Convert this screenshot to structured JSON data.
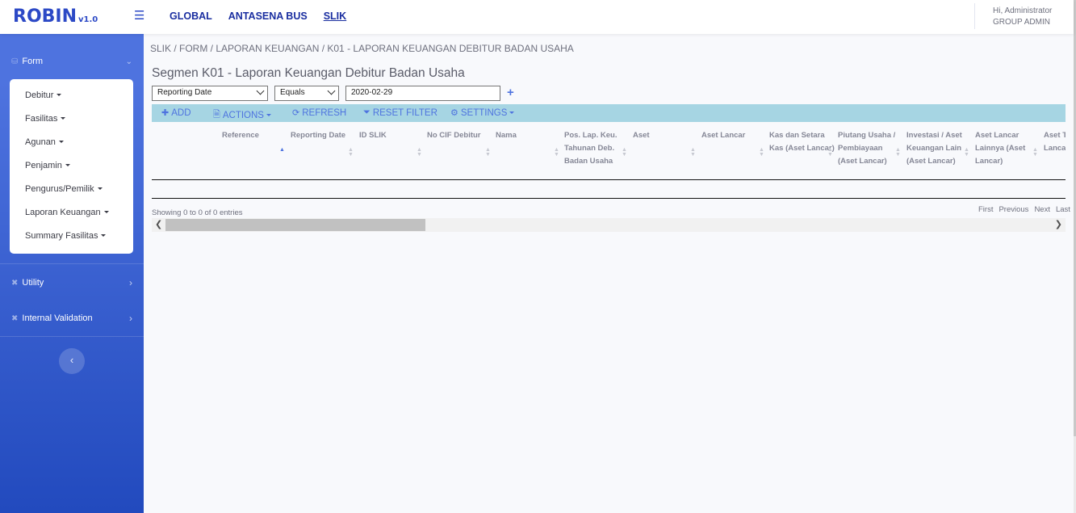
{
  "brand": {
    "name": "ROBIN",
    "version": "v1.0"
  },
  "topnav": [
    "GLOBAL",
    "ANTASENA BUS",
    "SLIK"
  ],
  "user": {
    "greeting": "Hi, Administrator",
    "group": "GROUP ADMIN"
  },
  "sidebar": {
    "form_label": "Form",
    "form_items": [
      "Debitur",
      "Fasilitas",
      "Agunan",
      "Penjamin",
      "Pengurus/Pemilik",
      "Laporan Keuangan",
      "Summary Fasilitas"
    ],
    "utility_label": "Utility",
    "internal_validation_label": "Internal Validation",
    "toggle_glyph": "‹"
  },
  "breadcrumb": "SLIK / FORM / LAPORAN KEUANGAN / K01 - LAPORAN KEUANGAN DEBITUR BADAN USAHA",
  "page_title": "Segmen K01 - Laporan Keuangan Debitur Badan Usaha",
  "filter": {
    "field": "Reporting Date",
    "operator": "Equals",
    "value": "2020-02-29"
  },
  "toolbar": {
    "add": "ADD",
    "actions": "ACTIONS",
    "refresh": "REFRESH",
    "reset_filter": "RESET FILTER",
    "settings": "SETTINGS"
  },
  "table": {
    "columns": [
      "Reference",
      "Reporting Date",
      "ID SLIK",
      "No CIF Debitur",
      "Nama",
      "Pos. Lap. Keu. Tahunan Deb. Badan Usaha",
      "Aset",
      "Aset Lancar",
      "Kas dan Setara Kas (Aset Lancar)",
      "Piutang Usaha / Pembiayaan (Aset Lancar)",
      "Investasi / Aset Keuangan Lain (Aset Lancar)",
      "Aset Lancar Lainnya (Aset Lancar)",
      "Aset T Lancar"
    ],
    "rows": [],
    "info": "Showing 0 to 0 of 0 entries",
    "pager": [
      "First",
      "Previous",
      "Next",
      "Last"
    ]
  },
  "colors": {
    "primary": "#4e73df",
    "toolbar_bg": "#a6d5e3",
    "sidebar_bottom": "#224abe"
  }
}
